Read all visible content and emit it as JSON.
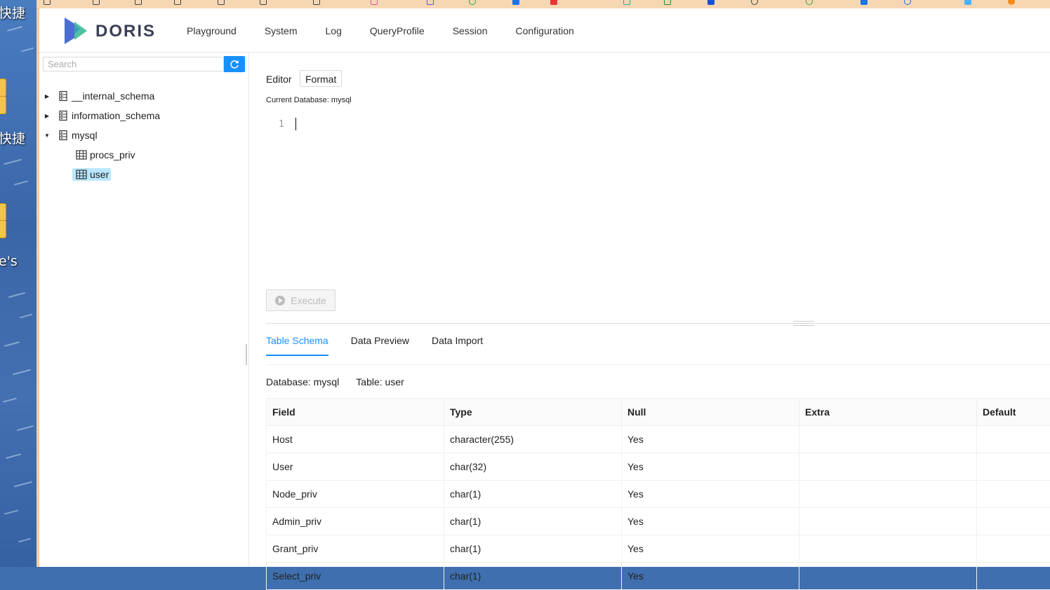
{
  "desktop": {
    "labels": [
      "快捷",
      "快捷",
      "e's"
    ]
  },
  "app": {
    "logo_text": "DORIS",
    "nav": [
      "Playground",
      "System",
      "Log",
      "QueryProfile",
      "Session",
      "Configuration"
    ],
    "colors": {
      "accent": "#1890ff",
      "selected_bg": "#bae7ff",
      "logo_blue": "#4a6fd1",
      "logo_green": "#4fc3a1"
    }
  },
  "sidebar": {
    "search_placeholder": "Search",
    "search_icon": "refresh-icon",
    "databases": [
      {
        "name": "__internal_schema",
        "expanded": false
      },
      {
        "name": "information_schema",
        "expanded": false
      },
      {
        "name": "mysql",
        "expanded": true,
        "tables": [
          {
            "name": "procs_priv",
            "selected": false
          },
          {
            "name": "user",
            "selected": true
          }
        ]
      }
    ]
  },
  "editor": {
    "label": "Editor",
    "format_label": "Format",
    "current_db": "Current Database: mysql",
    "line_number": "1",
    "execute_label": "Execute"
  },
  "result": {
    "tabs": [
      "Table Schema",
      "Data Preview",
      "Data Import"
    ],
    "active_tab": 0,
    "database_label": "Database: mysql",
    "table_label": "Table: user",
    "columns": [
      "Field",
      "Type",
      "Null",
      "Extra",
      "Default"
    ],
    "rows": [
      [
        "Host",
        "character(255)",
        "Yes",
        "",
        ""
      ],
      [
        "User",
        "char(32)",
        "Yes",
        "",
        ""
      ],
      [
        "Node_priv",
        "char(1)",
        "Yes",
        "",
        ""
      ],
      [
        "Admin_priv",
        "char(1)",
        "Yes",
        "",
        ""
      ],
      [
        "Grant_priv",
        "char(1)",
        "Yes",
        "",
        ""
      ],
      [
        "Select_priv",
        "char(1)",
        "Yes",
        "",
        ""
      ]
    ]
  }
}
